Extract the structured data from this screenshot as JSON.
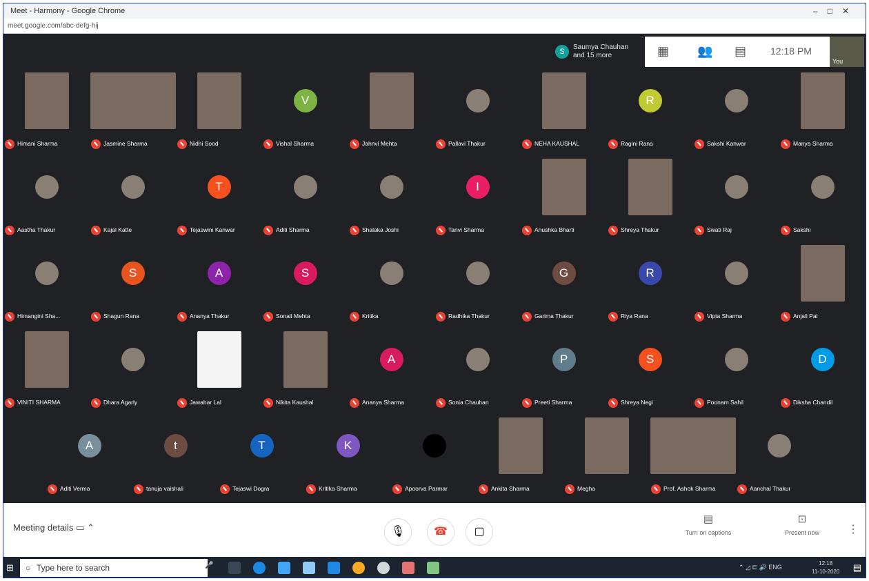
{
  "browser": {
    "title": "Meet - Harmony - Google Chrome",
    "url": "meet.google.com/abc-defg-hij"
  },
  "topbar": {
    "presenter_initial": "S",
    "presenter_text": "Saumya Chauhan and 15 more",
    "time": "12:18 PM",
    "you_label": "You"
  },
  "participants": [
    {
      "name": "Himani Sharma",
      "kind": "video"
    },
    {
      "name": "Jasmine Sharma",
      "kind": "video-wide"
    },
    {
      "name": "Nidhi Sood",
      "kind": "video"
    },
    {
      "name": "Vishal Sharma",
      "kind": "avatar",
      "initial": "V",
      "color": "#7cb342"
    },
    {
      "name": "Jahnvi Mehta",
      "kind": "video"
    },
    {
      "name": "Pallavi Thakur",
      "kind": "photo"
    },
    {
      "name": "NEHA KAUSHAL",
      "kind": "video"
    },
    {
      "name": "Ragini Rana",
      "kind": "avatar",
      "initial": "R",
      "color": "#c0ca33"
    },
    {
      "name": "Sakshi Kanwar",
      "kind": "photo"
    },
    {
      "name": "Manya Sharma",
      "kind": "video"
    },
    {
      "name": "Aastha Thakur",
      "kind": "photo"
    },
    {
      "name": "Kajal Katte",
      "kind": "photo"
    },
    {
      "name": "Tejaswini Kanwar",
      "kind": "avatar",
      "initial": "T",
      "color": "#f4511e"
    },
    {
      "name": "Aditi Sharma",
      "kind": "photo"
    },
    {
      "name": "Shalaka Joshi",
      "kind": "photo"
    },
    {
      "name": "Tanvi Sharma",
      "kind": "avatar",
      "initial": "I",
      "color": "#e91e63"
    },
    {
      "name": "Anushka Bharti",
      "kind": "video"
    },
    {
      "name": "Shreya Thakur",
      "kind": "video"
    },
    {
      "name": "Swati Raj",
      "kind": "photo"
    },
    {
      "name": "Sakshi",
      "kind": "photo"
    },
    {
      "name": "Himangini Sha...",
      "kind": "photo"
    },
    {
      "name": "Shagun Rana",
      "kind": "avatar",
      "initial": "S",
      "color": "#e8541e"
    },
    {
      "name": "Ananya Thakur",
      "kind": "avatar",
      "initial": "A",
      "color": "#8e24aa"
    },
    {
      "name": "Sonali Mehta",
      "kind": "avatar",
      "initial": "S",
      "color": "#d81b60"
    },
    {
      "name": "Kritika",
      "kind": "photo"
    },
    {
      "name": "Radhika Thakur",
      "kind": "photo"
    },
    {
      "name": "Garima Thakur",
      "kind": "avatar",
      "initial": "G",
      "color": "#6d4c41"
    },
    {
      "name": "Riya Rana",
      "kind": "avatar",
      "initial": "R",
      "color": "#3949ab"
    },
    {
      "name": "Vipta Sharma",
      "kind": "photo"
    },
    {
      "name": "Anjali Pal",
      "kind": "video"
    },
    {
      "name": "VINITI SHARMA",
      "kind": "video"
    },
    {
      "name": "Dhara Agarly",
      "kind": "photo"
    },
    {
      "name": "Jawahar Lal",
      "kind": "white"
    },
    {
      "name": "Nikita Kaushal",
      "kind": "video"
    },
    {
      "name": "Ananya Sharma",
      "kind": "avatar",
      "initial": "A",
      "color": "#d81b60"
    },
    {
      "name": "Sonia Chauhan",
      "kind": "photo"
    },
    {
      "name": "Preeti Sharma",
      "kind": "avatar",
      "initial": "P",
      "color": "#607d8b"
    },
    {
      "name": "Shreya Negi",
      "kind": "avatar",
      "initial": "S",
      "color": "#f4511e"
    },
    {
      "name": "Poonam Sahil",
      "kind": "photo"
    },
    {
      "name": "Diksha Chandil",
      "kind": "avatar",
      "initial": "D",
      "color": "#039be5"
    },
    {
      "name": "Aditi Verma",
      "kind": "avatar",
      "initial": "A",
      "color": "#78909c"
    },
    {
      "name": "tanuja vaishali",
      "kind": "avatar",
      "initial": "t",
      "color": "#6d4c41"
    },
    {
      "name": "Tejaswi Dogra",
      "kind": "avatar",
      "initial": "T",
      "color": "#1565c0"
    },
    {
      "name": "Kritika Sharma",
      "kind": "avatar",
      "initial": "K",
      "color": "#7e57c2"
    },
    {
      "name": "Apoorva Parmar",
      "kind": "avatar",
      "initial": "",
      "color": "#000000"
    },
    {
      "name": "Ankita Sharma",
      "kind": "video"
    },
    {
      "name": "Megha",
      "kind": "video"
    },
    {
      "name": "Prof. Ashok Sharma",
      "kind": "video-wide"
    },
    {
      "name": "Aanchal Thakur",
      "kind": "photo"
    }
  ],
  "bottombar": {
    "meeting_details": "Meeting details",
    "turn_on_captions": "Turn on captions",
    "present_now": "Present now"
  },
  "taskbar": {
    "search_placeholder": "Type here to search",
    "clock_time": "12:18",
    "clock_date": "11-10-2020"
  }
}
